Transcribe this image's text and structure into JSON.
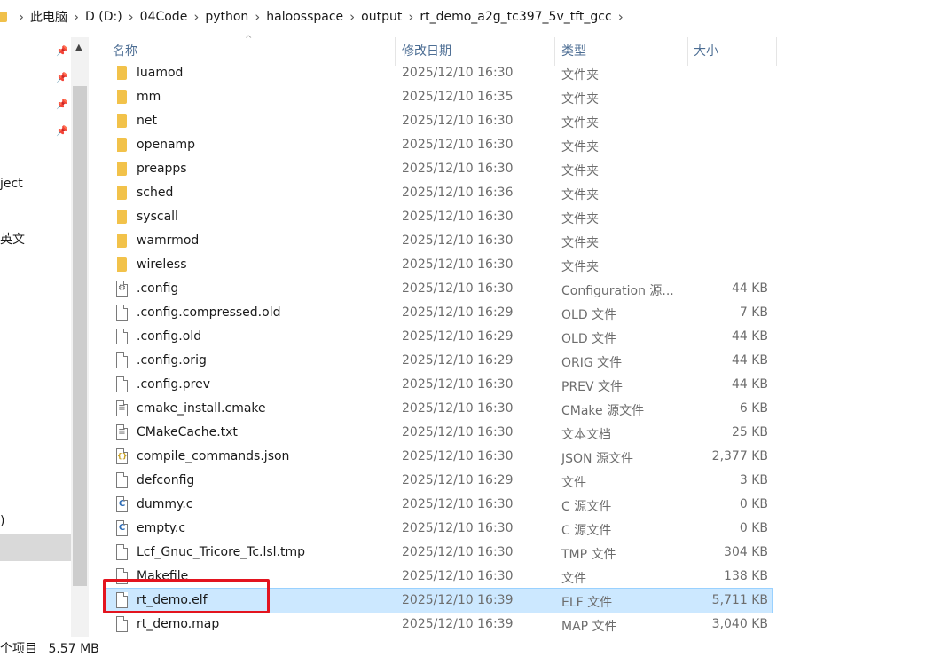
{
  "breadcrumb": [
    "此电脑",
    "D (D:)",
    "04Code",
    "python",
    "haloosspace",
    "output",
    "rt_demo_a2g_tc397_5v_tft_gcc"
  ],
  "nav": {
    "items": [
      "ject",
      "英文",
      ")"
    ]
  },
  "columns": {
    "name": "名称",
    "date": "修改日期",
    "type": "类型",
    "size": "大小"
  },
  "files": [
    {
      "name": "luamod",
      "date": "2025/12/10 16:30",
      "type": "文件夹",
      "size": "",
      "icon": "folder-icon"
    },
    {
      "name": "mm",
      "date": "2025/12/10 16:35",
      "type": "文件夹",
      "size": "",
      "icon": "folder-icon"
    },
    {
      "name": "net",
      "date": "2025/12/10 16:30",
      "type": "文件夹",
      "size": "",
      "icon": "folder-icon"
    },
    {
      "name": "openamp",
      "date": "2025/12/10 16:30",
      "type": "文件夹",
      "size": "",
      "icon": "folder-icon"
    },
    {
      "name": "preapps",
      "date": "2025/12/10 16:30",
      "type": "文件夹",
      "size": "",
      "icon": "folder-icon"
    },
    {
      "name": "sched",
      "date": "2025/12/10 16:36",
      "type": "文件夹",
      "size": "",
      "icon": "folder-icon"
    },
    {
      "name": "syscall",
      "date": "2025/12/10 16:30",
      "type": "文件夹",
      "size": "",
      "icon": "folder-icon"
    },
    {
      "name": "wamrmod",
      "date": "2025/12/10 16:30",
      "type": "文件夹",
      "size": "",
      "icon": "folder-icon"
    },
    {
      "name": "wireless",
      "date": "2025/12/10 16:30",
      "type": "文件夹",
      "size": "",
      "icon": "folder-icon"
    },
    {
      "name": ".config",
      "date": "2025/12/10 16:30",
      "type": "Configuration 源...",
      "size": "44 KB",
      "icon": "config-file-icon"
    },
    {
      "name": ".config.compressed.old",
      "date": "2025/12/10 16:29",
      "type": "OLD 文件",
      "size": "7 KB",
      "icon": "file-icon"
    },
    {
      "name": ".config.old",
      "date": "2025/12/10 16:29",
      "type": "OLD 文件",
      "size": "44 KB",
      "icon": "file-icon"
    },
    {
      "name": ".config.orig",
      "date": "2025/12/10 16:29",
      "type": "ORIG 文件",
      "size": "44 KB",
      "icon": "file-icon"
    },
    {
      "name": ".config.prev",
      "date": "2025/12/10 16:30",
      "type": "PREV 文件",
      "size": "44 KB",
      "icon": "file-icon"
    },
    {
      "name": "cmake_install.cmake",
      "date": "2025/12/10 16:30",
      "type": "CMake 源文件",
      "size": "6 KB",
      "icon": "text-file-icon"
    },
    {
      "name": "CMakeCache.txt",
      "date": "2025/12/10 16:30",
      "type": "文本文档",
      "size": "25 KB",
      "icon": "text-file-icon"
    },
    {
      "name": "compile_commands.json",
      "date": "2025/12/10 16:30",
      "type": "JSON 源文件",
      "size": "2,377 KB",
      "icon": "json-file-icon"
    },
    {
      "name": "defconfig",
      "date": "2025/12/10 16:29",
      "type": "文件",
      "size": "3 KB",
      "icon": "file-icon"
    },
    {
      "name": "dummy.c",
      "date": "2025/12/10 16:30",
      "type": "C 源文件",
      "size": "0 KB",
      "icon": "c-file-icon"
    },
    {
      "name": "empty.c",
      "date": "2025/12/10 16:30",
      "type": "C 源文件",
      "size": "0 KB",
      "icon": "c-file-icon"
    },
    {
      "name": "Lcf_Gnuc_Tricore_Tc.lsl.tmp",
      "date": "2025/12/10 16:30",
      "type": "TMP 文件",
      "size": "304 KB",
      "icon": "file-icon"
    },
    {
      "name": "Makefile",
      "date": "2025/12/10 16:30",
      "type": "文件",
      "size": "138 KB",
      "icon": "file-icon"
    },
    {
      "name": "rt_demo.elf",
      "date": "2025/12/10 16:39",
      "type": "ELF 文件",
      "size": "5,711 KB",
      "icon": "file-icon",
      "selected": true
    },
    {
      "name": "rt_demo.map",
      "date": "2025/12/10 16:39",
      "type": "MAP 文件",
      "size": "3,040 KB",
      "icon": "file-icon"
    }
  ],
  "status": {
    "items": "个项目",
    "selection_size": "5.57 MB"
  },
  "colors": {
    "selection_bg": "#cce8ff",
    "selection_border": "#99d1ff",
    "highlight_box": "#e3141f",
    "header_text": "#4d6e94",
    "folder": "#f2c24a"
  }
}
